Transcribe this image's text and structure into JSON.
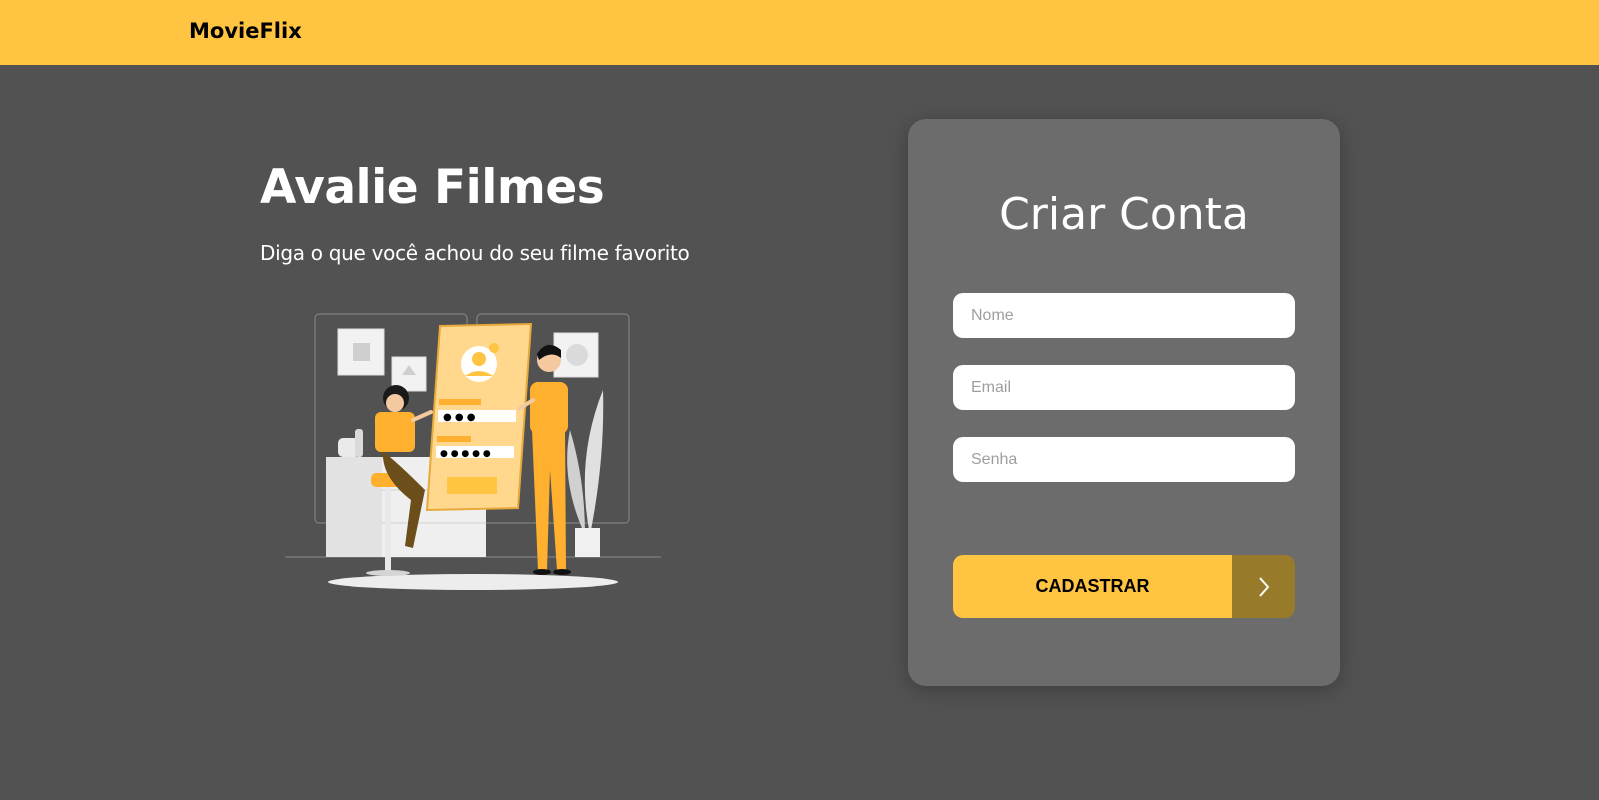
{
  "navbar": {
    "brand": "MovieFlix"
  },
  "hero": {
    "title": "Avalie Filmes",
    "subtitle": "Diga o que você achou do seu filme favorito",
    "illustration_icon": "signup-illustration"
  },
  "signup_card": {
    "title": "Criar Conta",
    "fields": {
      "name_placeholder": "Nome",
      "email_placeholder": "Email",
      "password_placeholder": "Senha"
    },
    "submit": {
      "label": "CADASTRAR",
      "icon": "chevron-right-icon"
    }
  },
  "colors": {
    "accent": "#FFC442",
    "background": "#525252",
    "card": "#6C6C6C",
    "button_arrow_bg": "#977A2A"
  }
}
